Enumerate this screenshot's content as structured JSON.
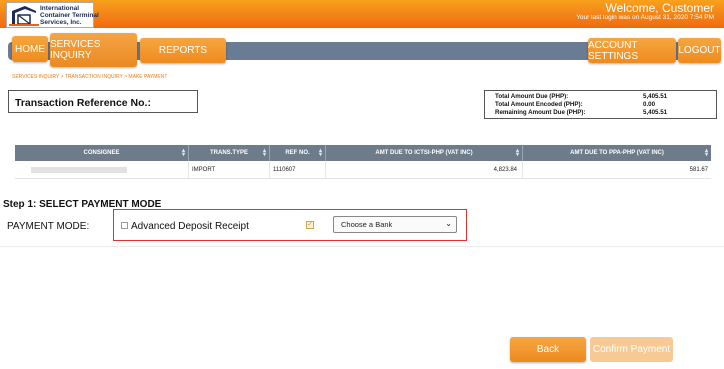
{
  "header": {
    "company_lines": "International\nContainer Terminal\nServices, Inc.",
    "welcome": "Welcome, Customer",
    "last_login": "Your last login was on August 31, 2020 7:54 PM"
  },
  "nav": {
    "home": "HOME",
    "services_inquiry": "SERVICES INQUIRY",
    "reports": "REPORTS",
    "account_settings": "ACCOUNT SETTINGS",
    "logout": "LOGOUT"
  },
  "breadcrumb": "SERVICES INQUIRY > TRANSACTION INQUIRY > MAKE PAYMENT",
  "transaction": {
    "label": "Transaction Reference No.:"
  },
  "totals": {
    "total_due_label": "Total Amount Due (PHP):",
    "total_due_value": "5,405.51",
    "total_encoded_label": "Total Amount Encoded (PHP):",
    "total_encoded_value": "0.00",
    "remaining_label": "Remaining Amount Due (PHP):",
    "remaining_value": "5,405.51"
  },
  "table": {
    "headers": [
      "CONSIGNEE",
      "TRANS.TYPE",
      "REF NO.",
      "AMT DUE TO ICTSI-PHP (VAT INC)",
      "AMT DUE TO PPA-PHP (VAT INC)"
    ],
    "rows": [
      {
        "consignee": "",
        "trans_type": "IMPORT",
        "ref_no": "1110607",
        "amt_ictsi": "4,823.84",
        "amt_ppa": "581.67"
      }
    ]
  },
  "payment": {
    "step_title": "Step 1: SELECT PAYMENT MODE",
    "mode_label": "PAYMENT MODE:",
    "adr_label": "Advanced Deposit Receipt",
    "bank_select_value": "Choose a Bank"
  },
  "actions": {
    "back": "Back",
    "confirm": "Confirm Payment"
  },
  "colors": {
    "accent_orange": "#ef8b1d",
    "nav_bar": "#6a7c93",
    "highlight_red": "#e03030"
  }
}
